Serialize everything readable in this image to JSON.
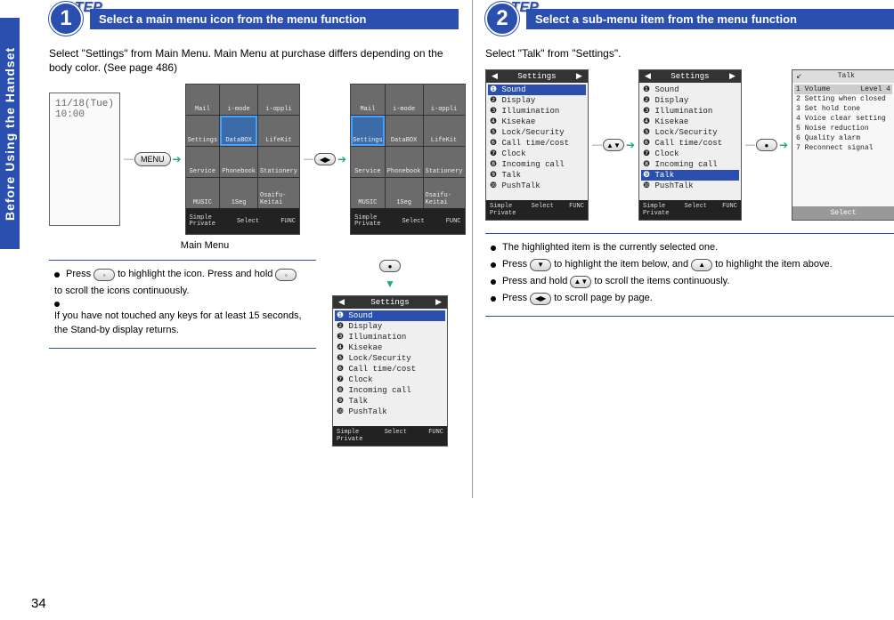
{
  "sidebar_label": "Before Using the Handset",
  "page_number": "34",
  "button_labels": {
    "menu": "MENU"
  },
  "step1": {
    "step_word": "STEP",
    "number": "1",
    "title": "Select a main menu icon from the menu function",
    "intro": "Select \"Settings\" from Main Menu. Main Menu at purchase differs depending on the body color. (See page 486)",
    "standby_clock": "11/18(Tue) 10:00",
    "main_menu_caption": "Main Menu",
    "grid_cells": [
      "Mail",
      "i-mode",
      "i-αppli",
      "Settings",
      "DataBOX",
      "LifeKit",
      "Service",
      "Phonebook",
      "Stationery",
      "MUSIC",
      "1Seg",
      "Osaifu-Keitai"
    ],
    "softkeys": {
      "left_top": "Simple",
      "left_bottom": "Private",
      "center": "Select",
      "right": "FUNC"
    },
    "settings_title": "Settings",
    "settings_items": [
      "Sound",
      "Display",
      "Illumination",
      "Kisekae",
      "Lock/Security",
      "Call time/cost",
      "Clock",
      "Incoming call",
      "Talk",
      "PushTalk"
    ],
    "notes": {
      "n1a": "Press",
      "n1b": "to highlight the icon. Press and hold",
      "n1c": "to scroll the icons continuously.",
      "n2": "If you have not touched any keys for at least 15 seconds, the Stand-by display returns."
    }
  },
  "step2": {
    "step_word": "STEP",
    "number": "2",
    "title": "Select a sub-menu item from the menu function",
    "intro": "Select \"Talk\" from \"Settings\".",
    "settings_title": "Settings",
    "settings_items": [
      "Sound",
      "Display",
      "Illumination",
      "Kisekae",
      "Lock/Security",
      "Call time/cost",
      "Clock",
      "Incoming call",
      "Talk",
      "PushTalk"
    ],
    "softkeys": {
      "left_top": "Simple",
      "left_bottom": "Private",
      "center": "Select",
      "right": "FUNC"
    },
    "talk_title": "Talk",
    "talk_first_label": "Volume",
    "talk_first_value": "Level 4",
    "talk_items": [
      "Setting when closed",
      "Set hold tone",
      "Voice clear setting",
      "Noise reduction",
      "Quality alarm",
      "Reconnect signal"
    ],
    "talk_soft_center": "Select",
    "notes": {
      "n1": "The highlighted item is the currently selected one.",
      "n2a": "Press",
      "n2b": "to highlight the item below, and",
      "n2c": "to highlight the item above.",
      "n3a": "Press and hold",
      "n3b": "to scroll the items continuously.",
      "n4a": "Press",
      "n4b": "to scroll page by page."
    }
  }
}
